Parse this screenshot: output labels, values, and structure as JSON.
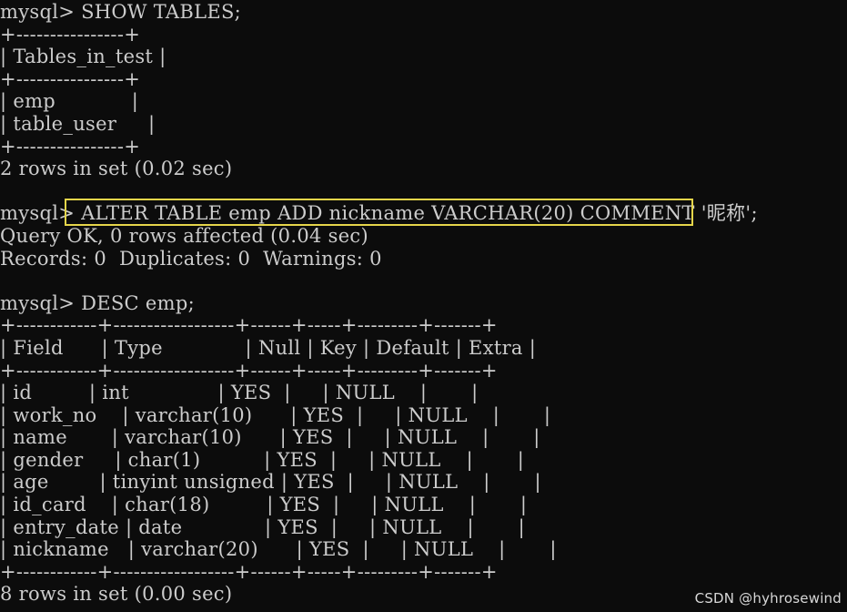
{
  "terminal": {
    "background": "#0c0c0c",
    "foreground": "#cccccc",
    "highlight_color": "#e5d54a",
    "lines": [
      "mysql> SHOW TABLES;",
      "+----------------+",
      "| Tables_in_test |",
      "+----------------+",
      "| emp            |",
      "| table_user     |",
      "+----------------+",
      "2 rows in set (0.02 sec)",
      "",
      "mysql> ALTER TABLE emp ADD nickname VARCHAR(20) COMMENT '昵称';",
      "Query OK, 0 rows affected (0.04 sec)",
      "Records: 0  Duplicates: 0  Warnings: 0",
      "",
      "mysql> DESC emp;",
      "+------------+------------------+------+-----+---------+-------+",
      "| Field      | Type             | Null | Key | Default | Extra |",
      "+------------+------------------+------+-----+---------+-------+",
      "| id         | int              | YES  |     | NULL    |       |",
      "| work_no    | varchar(10)      | YES  |     | NULL    |       |",
      "| name       | varchar(10)      | YES  |     | NULL    |       |",
      "| gender     | char(1)          | YES  |     | NULL    |       |",
      "| age        | tinyint unsigned | YES  |     | NULL    |       |",
      "| id_card    | char(18)         | YES  |     | NULL    |       |",
      "| entry_date | date             | YES  |     | NULL    |       |",
      "| nickname   | varchar(20)      | YES  |     | NULL    |       |",
      "+------------+------------------+------+-----+---------+-------+",
      "8 rows in set (0.00 sec)"
    ]
  },
  "watermark": "CSDN @hyhrosewind"
}
